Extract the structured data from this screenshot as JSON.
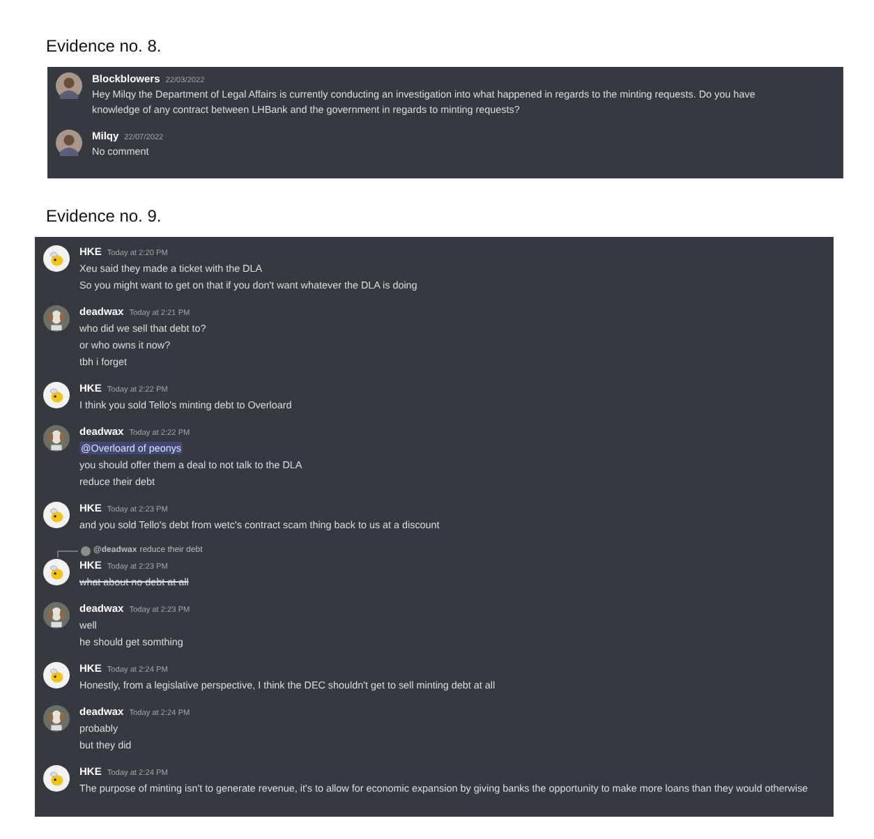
{
  "sections": [
    {
      "heading": "Evidence no. 8.",
      "messages": [
        {
          "author": "Blockblowers",
          "time": "22/03/2022",
          "kind": "photo",
          "lines": [
            {
              "kind": "plain",
              "text": "Hey Milqy the Department of Legal Affairs is currently conducting an investigation into what happened in regards to the minting requests. Do you have knowledge of any contract between LHBank and the government in regards to minting requests?"
            }
          ]
        },
        {
          "author": "Milqy",
          "time": "22/07/2022",
          "kind": "photo",
          "lines": [
            {
              "kind": "plain",
              "text": "No comment"
            }
          ]
        }
      ]
    },
    {
      "heading": "Evidence no. 9.",
      "messages": [
        {
          "author": "HKE",
          "time": "Today at 2:20 PM",
          "kind": "bee",
          "lines": [
            {
              "kind": "plain",
              "text": "Xeu said they made a ticket with the DLA"
            },
            {
              "kind": "plain",
              "text": "So you might want to get on that if you don't want whatever the DLA is doing"
            }
          ]
        },
        {
          "author": "deadwax",
          "time": "Today at 2:21 PM",
          "kind": "dog",
          "lines": [
            {
              "kind": "plain",
              "text": "who did we sell that debt to?"
            },
            {
              "kind": "plain",
              "text": "or who owns it now?"
            },
            {
              "kind": "plain",
              "text": "tbh i forget"
            }
          ]
        },
        {
          "author": "HKE",
          "time": "Today at 2:22 PM",
          "kind": "bee",
          "lines": [
            {
              "kind": "plain",
              "text": "I think you sold Tello's minting debt to Overloard"
            }
          ]
        },
        {
          "author": "deadwax",
          "time": "Today at 2:22 PM",
          "kind": "dog",
          "lines": [
            {
              "kind": "mention",
              "text": "@Overloard of peonys"
            },
            {
              "kind": "plain",
              "text": "you should offer them a deal to not talk to the DLA"
            },
            {
              "kind": "plain",
              "text": "reduce their debt"
            }
          ]
        },
        {
          "author": "HKE",
          "time": "Today at 2:23 PM",
          "kind": "bee",
          "lines": [
            {
              "kind": "plain",
              "text": "and you sold Tello's debt from wetc's contract scam thing back to us at a discount"
            }
          ]
        },
        {
          "author": "HKE",
          "time": "Today at 2:23 PM",
          "kind": "bee",
          "reply": {
            "author": "@deadwax",
            "text": "reduce their debt"
          },
          "lines": [
            {
              "kind": "strike",
              "text": "what about no debt at all"
            }
          ]
        },
        {
          "author": "deadwax",
          "time": "Today at 2:23 PM",
          "kind": "dog",
          "lines": [
            {
              "kind": "plain",
              "text": "well"
            },
            {
              "kind": "plain",
              "text": "he should get somthing"
            }
          ]
        },
        {
          "author": "HKE",
          "time": "Today at 2:24 PM",
          "kind": "bee",
          "lines": [
            {
              "kind": "plain",
              "text": "Honestly, from a legislative perspective, I think the DEC shouldn't get to sell minting debt at all"
            }
          ]
        },
        {
          "author": "deadwax",
          "time": "Today at 2:24 PM",
          "kind": "dog",
          "lines": [
            {
              "kind": "plain",
              "text": "probably"
            },
            {
              "kind": "plain",
              "text": "but they did"
            }
          ]
        },
        {
          "author": "HKE",
          "time": "Today at 2:24 PM",
          "kind": "bee",
          "lines": [
            {
              "kind": "plain",
              "text": "The purpose of minting isn't to generate revenue, it's to allow for economic expansion by giving banks the opportunity to make more loans than they would otherwise"
            }
          ]
        }
      ]
    }
  ]
}
